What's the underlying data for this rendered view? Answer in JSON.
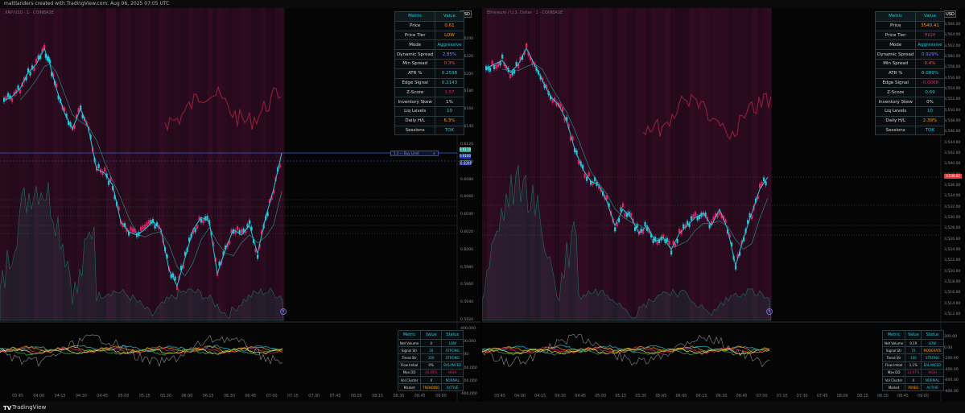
{
  "header": {
    "text": "mattlanders created with TradingView.com, Aug 06, 2025 07:05 UTC"
  },
  "footer": {
    "logo": "TV",
    "brand": "TradingView"
  },
  "colors": {
    "bg": "#050505",
    "up": "#26c6da",
    "down": "#e91e63",
    "purple": "#7b4ba8",
    "table_border": "#2b3a3e",
    "accent": "#26c6da"
  },
  "left": {
    "symbol": "XRP/USD · 1 · COINBASE",
    "currency": "USD",
    "price_axis": [
      "0.6240",
      "0.6220",
      "0.6200",
      "0.6180",
      "0.6160",
      "0.6140",
      "0.6120",
      "0.6100",
      "0.6080",
      "0.6060",
      "0.6040",
      "0.6020",
      "0.6000",
      "0.5980",
      "0.5960",
      "0.5940",
      "0.5920"
    ],
    "price_tags": [
      "0.6110",
      "0.6100",
      "0.6090"
    ],
    "order_label": "1.4 — Buy Limit",
    "osc_axis": [
      "400,000",
      "200,000",
      "0.00",
      "-200,000",
      "-400,000",
      "-600,000"
    ],
    "time_axis": [
      "03:45",
      "04:00",
      "04:15",
      "04:30",
      "04:45",
      "05:00",
      "05:15",
      "05:30",
      "06:00",
      "06:15",
      "06:30",
      "06:45",
      "07:00",
      "07:15",
      "07:30",
      "07:45",
      "08:00",
      "08:15",
      "08:30",
      "08:45",
      "09:00"
    ],
    "table": {
      "headers": [
        "Metric",
        "Value"
      ],
      "rows": [
        [
          "Price",
          "0.61"
        ],
        [
          "Price Tier",
          "LOW"
        ],
        [
          "Mode",
          "Aggressive"
        ],
        [
          "Dynamic Spread",
          "2.85%"
        ],
        [
          "Min Spread",
          "0.3%"
        ],
        [
          "ATR %",
          "0.2598"
        ],
        [
          "Edge Signal",
          "0.2143"
        ],
        [
          "Z-Score",
          "1.57"
        ],
        [
          "Inventory Skew",
          "1%"
        ],
        [
          "Liq Levels",
          "10"
        ],
        [
          "Daily H/L",
          "6.3%"
        ],
        [
          "Sessions",
          "TOK"
        ]
      ],
      "value_colors": [
        "#ff9800",
        "#ff9800",
        "#26c6da",
        "#7c83fd",
        "#ef5350",
        "#26c6da",
        "#26c6da",
        "#e91e63",
        "#d1d4dc",
        "#26c6da",
        "#ff9800",
        "#26c6da"
      ]
    },
    "table2": {
      "headers": [
        "Metric",
        "Value",
        "Status"
      ],
      "rows": [
        [
          "Net Volume",
          "0",
          "LOW"
        ],
        [
          "Signal Str",
          "30",
          "STRONG"
        ],
        [
          "Trend Str",
          "100",
          "STRONG"
        ],
        [
          "Flow Imbal",
          "0%",
          "BALANCED"
        ],
        [
          "Max DD",
          "26.85%",
          "HIGH"
        ],
        [
          "Vol Cluster",
          "4",
          "NORMAL"
        ],
        [
          "Market",
          "TRENDING",
          "ACTIVE"
        ]
      ],
      "value_colors": [
        "#d1d4dc",
        "#26c6da",
        "#26c6da",
        "#d1d4dc",
        "#e91e63",
        "#d1d4dc",
        "#ff9800"
      ],
      "status_colors": [
        "#26c6da",
        "#26c6da",
        "#26c6da",
        "#26c6da",
        "#e91e63",
        "#26c6da",
        "#26c6da"
      ]
    }
  },
  "right": {
    "symbol": "Ethereum / U.S. Dollar · 1 · COINBASE",
    "currency": "USD",
    "price_axis": [
      "3,566.00",
      "3,564.00",
      "3,562.00",
      "3,560.00",
      "3,558.00",
      "3,556.00",
      "3,554.00",
      "3,552.00",
      "3,550.00",
      "3,548.00",
      "3,546.00",
      "3,544.00",
      "3,542.00",
      "3,540.00",
      "3,538.00",
      "3,536.00",
      "3,534.00",
      "3,532.00",
      "3,530.00",
      "3,528.00",
      "3,526.00",
      "3,524.00",
      "3,522.00",
      "3,520.00",
      "3,518.00",
      "3,516.00",
      "3,514.00",
      "3,512.00"
    ],
    "price_tag": "3,539.82",
    "osc_axis": [
      "200.00",
      "0.00",
      "-200.00",
      "-400.00",
      "-600.00",
      "-800.00"
    ],
    "time_axis": [
      "03:45",
      "04:00",
      "04:15",
      "04:30",
      "04:45",
      "05:00",
      "05:15",
      "05:30",
      "05:45",
      "06:00",
      "06:15",
      "06:30",
      "06:45",
      "07:00",
      "07:15",
      "07:30",
      "07:45",
      "08:00",
      "08:15",
      "08:30",
      "08:45",
      "09:00"
    ],
    "table": {
      "headers": [
        "Metric",
        "Value"
      ],
      "rows": [
        [
          "Price",
          "3540.41"
        ],
        [
          "Price Tier",
          "HIGH"
        ],
        [
          "Mode",
          "Aggressive"
        ],
        [
          "Dynamic Spread",
          "0.929%"
        ],
        [
          "Min Spread",
          "0.4%"
        ],
        [
          "ATR %",
          "0.089%"
        ],
        [
          "Edge Signal",
          "-0.0068"
        ],
        [
          "Z-Score",
          "0.69"
        ],
        [
          "Inventory Skew",
          "0%"
        ],
        [
          "Liq Levels",
          "10"
        ],
        [
          "Daily H/L",
          "2.39%"
        ],
        [
          "Sessions",
          "TOK"
        ]
      ],
      "value_colors": [
        "#ff9800",
        "#e91e63",
        "#26c6da",
        "#7c83fd",
        "#ef5350",
        "#26c6da",
        "#e91e63",
        "#26c6da",
        "#d1d4dc",
        "#26c6da",
        "#ff9800",
        "#26c6da"
      ]
    },
    "table2": {
      "headers": [
        "Metric",
        "Value",
        "Status"
      ],
      "rows": [
        [
          "Net Volume",
          "0.19",
          "LOW"
        ],
        [
          "Signal Str",
          "70",
          "MODERATE"
        ],
        [
          "Trend Str",
          "100",
          "STRONG"
        ],
        [
          "Flow Imbal",
          "1.1%",
          "BALANCED"
        ],
        [
          "Max DD",
          "14.97%",
          "HIGH"
        ],
        [
          "Vol Cluster",
          "4",
          "NORMAL"
        ],
        [
          "Market",
          "MIXED",
          "ACTIVE"
        ]
      ],
      "value_colors": [
        "#d1d4dc",
        "#26c6da",
        "#26c6da",
        "#d1d4dc",
        "#e91e63",
        "#d1d4dc",
        "#ff9800"
      ],
      "status_colors": [
        "#26c6da",
        "#ff9800",
        "#26c6da",
        "#26c6da",
        "#e91e63",
        "#26c6da",
        "#26c6da"
      ]
    }
  }
}
